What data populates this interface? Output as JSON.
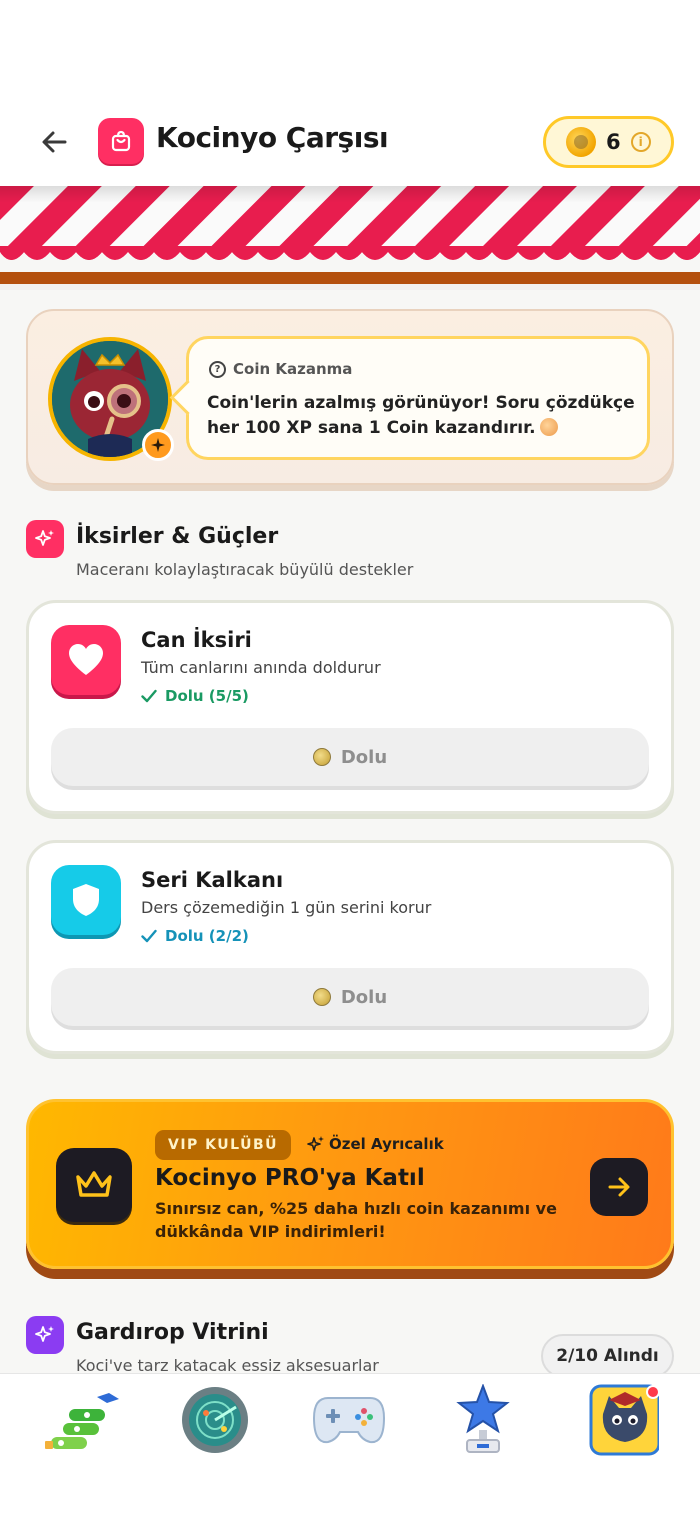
{
  "header": {
    "title": "Kocinyo Çarşısı",
    "coins": "6"
  },
  "hint": {
    "heading": "Coin Kazanma",
    "text": "Coin'lerin azalmış görünüyor! Soru çözdükçe her 100 XP sana 1 Coin kazandırır."
  },
  "potions_section": {
    "title": "İksirler & Güçler",
    "subtitle": "Maceranı kolaylaştıracak büyülü destekler"
  },
  "items": [
    {
      "name": "Can İksiri",
      "description": "Tüm canlarını anında doldurur",
      "status": "Dolu (5/5)",
      "button_label": "Dolu",
      "status_color": "#1a9a63",
      "icon": "heart-icon"
    },
    {
      "name": "Seri Kalkanı",
      "description": "Ders çözemediğin 1 gün serini korur",
      "status": "Dolu (2/2)",
      "button_label": "Dolu",
      "status_color": "#1592b8",
      "icon": "shield-icon"
    }
  ],
  "vip": {
    "badge": "VIP KULÜBÜ",
    "special": "Özel Ayrıcalık",
    "title": "Kocinyo PRO'ya Katıl",
    "description": "Sınırsız can, %25 daha hızlı coin kazanımı ve dükkânda VIP indirimleri!"
  },
  "wardrobe_section": {
    "title": "Gardırop Vitrini",
    "subtitle": "Koci've tarz katacak essiz aksesuarlar",
    "count": "2/10 Alındı"
  },
  "colors": {
    "accent_pink": "#ff2f63",
    "coin_gold": "#ffc928",
    "vip_orange": "#ff9a10",
    "wardrobe_purple": "#8b3cf2"
  },
  "nav": [
    "path-icon",
    "radar-icon",
    "gamepad-icon",
    "trophy-icon",
    "profile-avatar-icon"
  ]
}
